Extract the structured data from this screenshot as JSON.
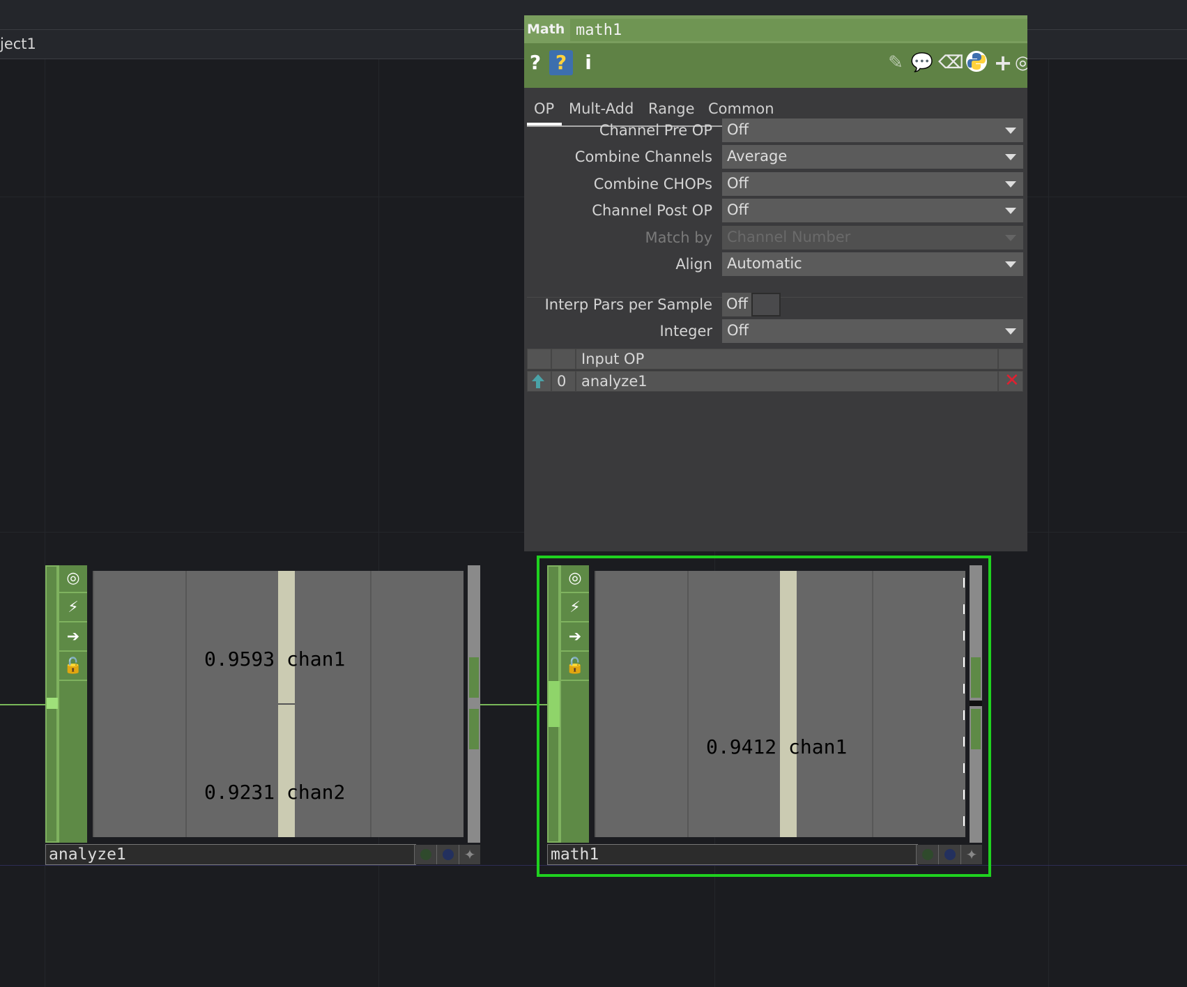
{
  "path": {
    "label": "ject1"
  },
  "param_panel": {
    "op_type": "Math",
    "op_name": "math1",
    "toolbar": {
      "help_icon": "question-icon",
      "python_help_icon": "python-help-icon",
      "info_icon": "info-icon",
      "right_icons": [
        "pencil-icon",
        "comment-icon",
        "clear-icon",
        "python-icon",
        "plus-icon",
        "target-icon"
      ]
    },
    "tabs": [
      "OP",
      "Mult-Add",
      "Range",
      "Common"
    ],
    "active_tab": "OP",
    "params": [
      {
        "label": "Channel Pre OP",
        "value": "Off",
        "enabled": true
      },
      {
        "label": "Combine Channels",
        "value": "Average",
        "enabled": true
      },
      {
        "label": "Combine CHOPs",
        "value": "Off",
        "enabled": true
      },
      {
        "label": "Channel Post OP",
        "value": "Off",
        "enabled": true
      },
      {
        "label": "Match by",
        "value": "Channel Number",
        "enabled": false
      },
      {
        "label": "Align",
        "value": "Automatic",
        "enabled": true
      }
    ],
    "interp": {
      "label": "Interp Pars per Sample",
      "value": "Off"
    },
    "integer": {
      "label": "Integer",
      "value": "Off"
    },
    "input_table": {
      "header": "Input OP",
      "rows": [
        {
          "index": "0",
          "name": "analyze1"
        }
      ]
    }
  },
  "nodes": [
    {
      "name": "analyze1",
      "channels": [
        {
          "value": "0.9593",
          "name": "chan1"
        },
        {
          "value": "0.9231",
          "name": "chan2"
        }
      ]
    },
    {
      "name": "math1",
      "selected": true,
      "channels": [
        {
          "value": "0.9412",
          "name": "chan1"
        }
      ]
    }
  ],
  "colors": {
    "op_green": "#7a9e5e",
    "selection": "#1fd11f",
    "bar": "#cbcbb2",
    "delete_red": "#e02030"
  }
}
